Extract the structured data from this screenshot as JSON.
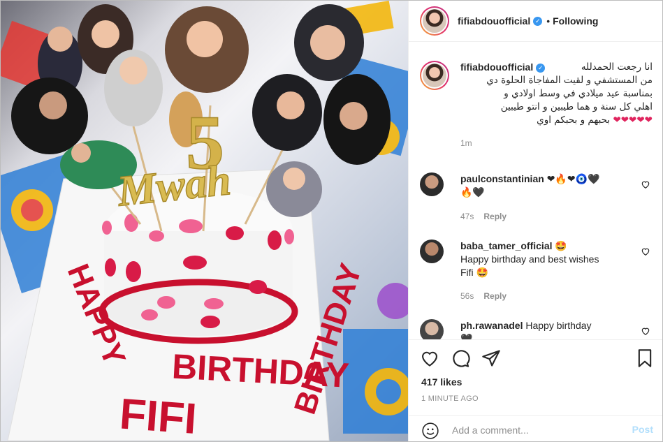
{
  "post": {
    "username": "fifiabdouofficial",
    "verified": "✓",
    "separator": "•",
    "follow_state": "Following"
  },
  "caption": {
    "username": "fifiabdouofficial",
    "text_lines": [
      "انا رجعت الحمدلله",
      "من المستشفي و لقيت المفاجاة الحلوة دي",
      "بمناسبة عيد ميلادي في وسط اولادي و",
      "اهلي كل سنة و هما طيبين و انتو طيبين",
      "بحبهم و بحبكم اوي"
    ],
    "hearts": "❤❤❤❤❤",
    "time": "1m"
  },
  "comments": [
    {
      "username": "paulconstantinian",
      "text": "❤🔥❤🧿🖤",
      "text2": "🔥🖤",
      "time": "47s",
      "reply": "Reply"
    },
    {
      "username": "baba_tamer_official",
      "text": "🤩",
      "text2": "Happy birthday and best wishes",
      "text3": "Fifi 🤩",
      "time": "56s",
      "reply": "Reply"
    },
    {
      "username": "ph.rawanadel",
      "text": "Happy birthday",
      "text2": "🖤"
    }
  ],
  "actions": {
    "likes": "417 likes",
    "posted": "1 MINUTE AGO"
  },
  "add_comment": {
    "placeholder": "Add a comment...",
    "post_label": "Post"
  },
  "cake": {
    "topper_number": "5",
    "topper_word": "Mwah",
    "line1": "HAPPY BIRTHDAY",
    "line2": "BIRTHDAY",
    "line3": "FIFI",
    "plate_left": "HAPPY",
    "plate_right": "BIRTHDAY"
  },
  "colors": {
    "brand_blue": "#3897f0",
    "heart_red": "#e0245e",
    "text_gray": "#8e8e8e",
    "fondant_red": "#c8102e"
  }
}
